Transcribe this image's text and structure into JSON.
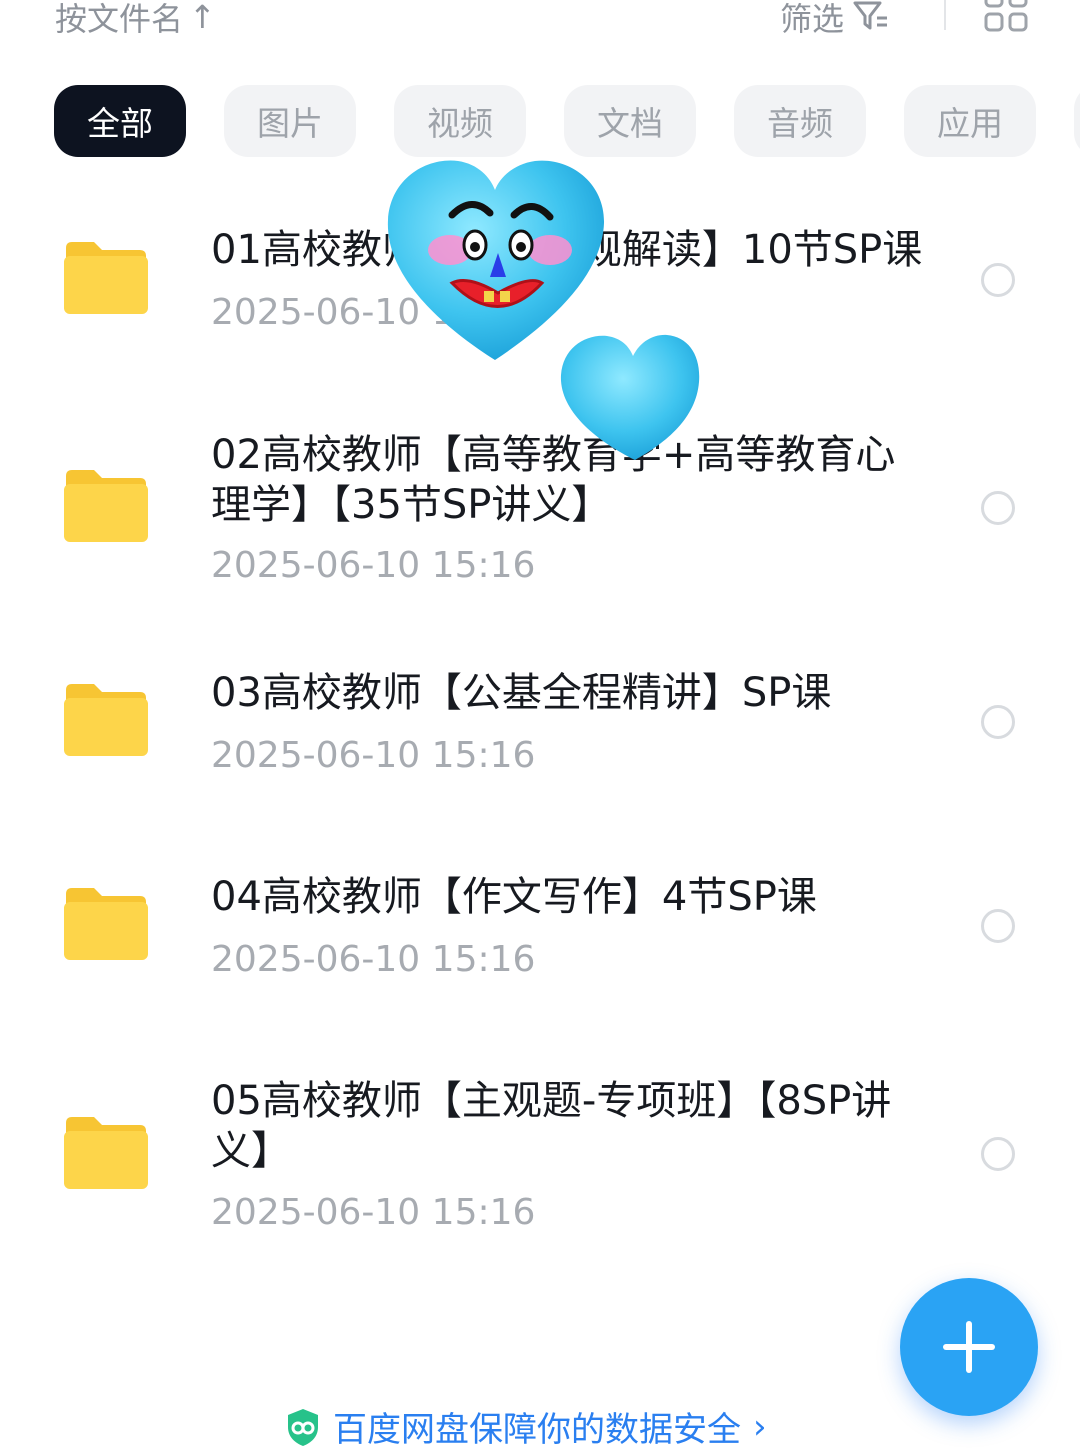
{
  "header": {
    "sort_label": "按文件名",
    "sort_arrow": "↑",
    "filter_label": "筛选"
  },
  "tabs": [
    {
      "label": "全部",
      "active": true
    },
    {
      "label": "图片",
      "active": false
    },
    {
      "label": "视频",
      "active": false
    },
    {
      "label": "文档",
      "active": false
    },
    {
      "label": "音频",
      "active": false
    },
    {
      "label": "应用",
      "active": false
    },
    {
      "label": "",
      "active": false
    }
  ],
  "files": [
    {
      "name": "01高校教师【政策法规解读】10节SP课",
      "date": "2025-06-10  15:16"
    },
    {
      "name": "02高校教师【高等教育学+高等教育心理学】【35节SP讲义】",
      "date": "2025-06-10  15:16"
    },
    {
      "name": "03高校教师【公基全程精讲】SP课",
      "date": "2025-06-10  15:16"
    },
    {
      "name": "04高校教师【作文写作】4节SP课",
      "date": "2025-06-10  15:16"
    },
    {
      "name": "05高校教师【主观题-专项班】【8SP讲义】",
      "date": "2025-06-10  15:16"
    }
  ],
  "footer": {
    "security_text": "百度网盘保障你的数据安全",
    "chevron": "›"
  },
  "colors": {
    "accent": "#2aa3f4",
    "folder": "#fdd54a",
    "active_tab": "#0d1320"
  },
  "icons": {
    "filter": "filter-icon",
    "grid": "grid-view-icon",
    "folder": "folder-icon",
    "add": "plus-icon",
    "shield": "shield-icon"
  }
}
